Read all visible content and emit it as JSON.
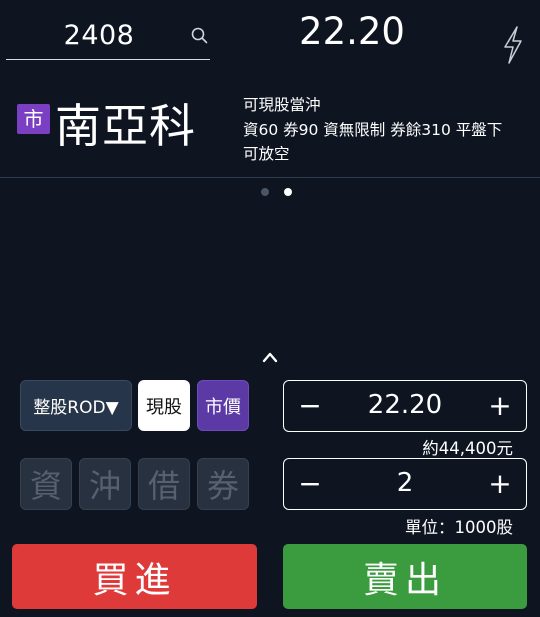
{
  "header": {
    "symbol_value": "2408",
    "price": "22.20"
  },
  "stock": {
    "market_badge": "市",
    "name": "南亞科",
    "desc_line1": "可現股當沖",
    "desc_line2": "資60 券90 資無限制 券餘310 平盤下",
    "desc_line3": "可放空"
  },
  "pager": {
    "total": 2,
    "active": 2
  },
  "order": {
    "order_type_label": "整股ROD▼",
    "cash_label": "現股",
    "market_price_label": "市價",
    "credit": [
      "資",
      "沖",
      "借",
      "券"
    ]
  },
  "price_stepper": {
    "minus": "−",
    "value": "22.20",
    "plus": "+"
  },
  "estimate": "約44,400元",
  "qty_stepper": {
    "minus": "−",
    "value": "2",
    "plus": "+"
  },
  "unit": "單位：1000股",
  "actions": {
    "buy": "買進",
    "sell": "賣出"
  },
  "colors": {
    "background": "#0e1521",
    "buy": "#de3a3a",
    "sell": "#3b9b3f",
    "badge": "#7a3fc2",
    "market_price_btn": "#5b3aa6"
  }
}
